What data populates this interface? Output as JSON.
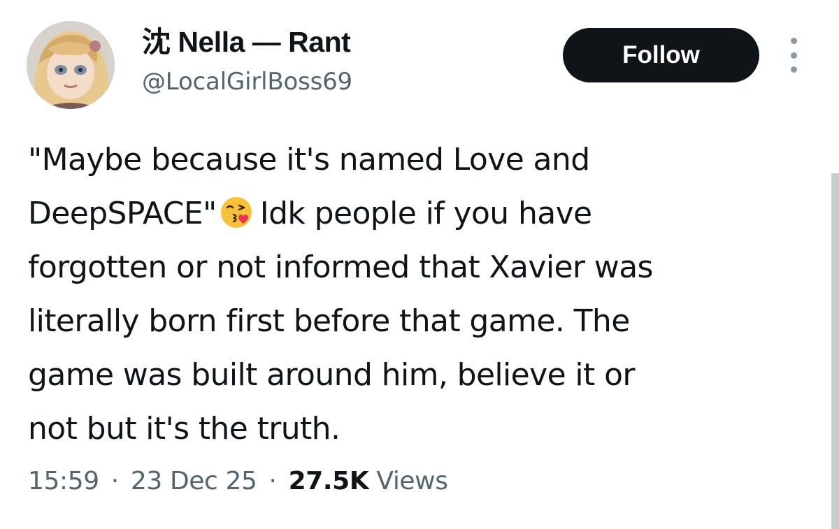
{
  "author": {
    "display_name": "沈 Nella — Rant",
    "handle": "@LocalGirlBoss69"
  },
  "follow_button": {
    "label": "Follow"
  },
  "more_menu": {
    "icon": "more-vertical-icon"
  },
  "tweet": {
    "lines": [
      "\"Maybe because it's named Love and",
      "DeepSPACE\"",
      "Idk people if you have",
      "forgotten or not informed that Xavier was",
      "literally born first before that game. The",
      "game was built around him, believe it or",
      "not but it's the truth."
    ],
    "emoji": "face-blowing-a-kiss-emoji"
  },
  "meta": {
    "time": "15:59",
    "separator": "·",
    "date": "23 Dec 25",
    "views_count": "27.5K",
    "views_label": "Views"
  },
  "colors": {
    "text_primary": "#0f1419",
    "text_secondary": "#536471",
    "button_bg": "#0f1419",
    "button_text": "#ffffff"
  }
}
